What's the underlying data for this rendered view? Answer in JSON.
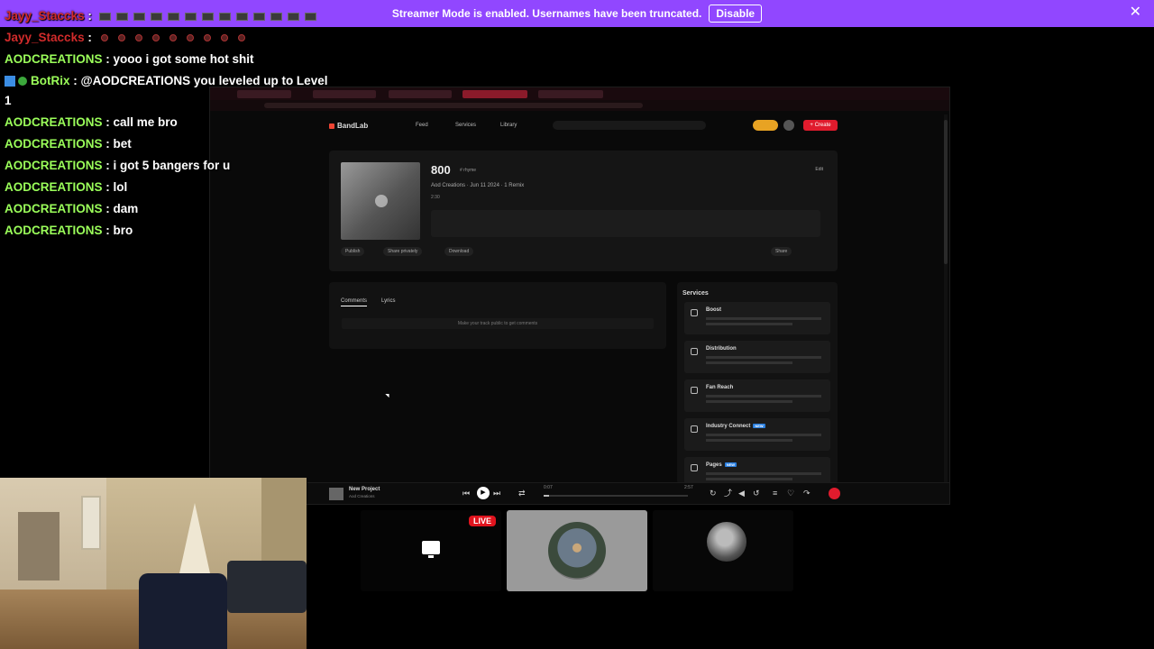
{
  "banner": {
    "text": "Streamer Mode is enabled. Usernames have been truncated.",
    "disable_label": "Disable",
    "close_glyph": "✕"
  },
  "chat": [
    {
      "user": "Jayy_Staccks",
      "sep": " :",
      "message": "",
      "color": "#d12b2b",
      "emotes": 13,
      "emote_style": "box"
    },
    {
      "user": "Jayy_Staccks",
      "sep": " :",
      "message": "",
      "color": "#d12b2b",
      "emotes": 9,
      "emote_style": "dot"
    },
    {
      "user": "AODCREATIONS",
      "sep": " :",
      "message": " yooo i got some hot shit",
      "color": "#9bff5a"
    },
    {
      "user": "BotRix",
      "sep": " :",
      "message": " @AODCREATIONS you leveled up to Level",
      "color": "#9bff5a",
      "badges": [
        "bot-badge",
        "verified-badge"
      ]
    },
    {
      "user": "",
      "sep": "",
      "message": "1",
      "color": "#fff"
    },
    {
      "user": "AODCREATIONS",
      "sep": " :",
      "message": " call me bro",
      "color": "#9bff5a"
    },
    {
      "user": "AODCREATIONS",
      "sep": " :",
      "message": " bet",
      "color": "#9bff5a"
    },
    {
      "user": "AODCREATIONS",
      "sep": " :",
      "message": " i got 5 bangers for u",
      "color": "#9bff5a"
    },
    {
      "user": "AODCREATIONS",
      "sep": " :",
      "message": " lol",
      "color": "#9bff5a"
    },
    {
      "user": "AODCREATIONS",
      "sep": " :",
      "message": " dam",
      "color": "#9bff5a"
    },
    {
      "user": "AODCREATIONS",
      "sep": " :",
      "message": " bro",
      "color": "#9bff5a"
    }
  ],
  "bandlab": {
    "logo": "BandLab",
    "nav": [
      "Feed",
      "Services",
      "Library"
    ],
    "create_label": "+ Create",
    "track": {
      "title": "800",
      "tag": "# rhyme",
      "meta": "Aod Creations · Jun 11 2024 · 1 Remix",
      "duration": "2:30",
      "edit_label": "Edit",
      "buttons": [
        "Publish",
        "Share privately",
        "Download"
      ],
      "right_button": "Share"
    },
    "comments": {
      "tabs": [
        "Comments",
        "Lyrics"
      ],
      "empty_text": "Make your track public to get comments"
    },
    "services": {
      "heading": "Services",
      "items": [
        {
          "title": "Boost",
          "new": false
        },
        {
          "title": "Distribution",
          "new": false
        },
        {
          "title": "Fan Reach",
          "new": false
        },
        {
          "title": "Industry Connect",
          "new": true
        },
        {
          "title": "Pages",
          "new": true
        }
      ],
      "new_label": "NEW"
    },
    "player": {
      "title": "New Project",
      "subtitle": "Aod Creations",
      "elapsed": "0:07",
      "total": "2:57",
      "progress": 0.04
    }
  },
  "call": {
    "live_label": "LIVE"
  },
  "colors": {
    "banner": "#9147ff",
    "accent_red": "#e01b2d",
    "live_red": "#e0141e"
  }
}
